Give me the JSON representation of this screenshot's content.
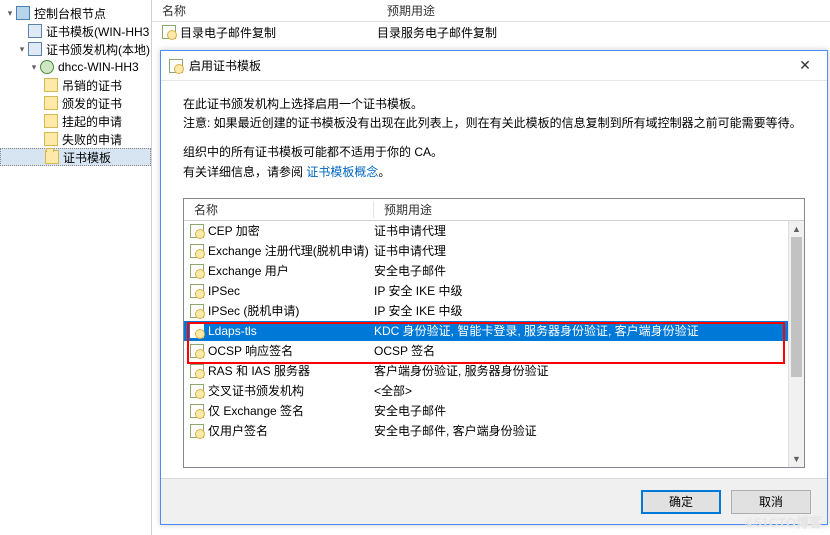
{
  "mmc": {
    "tree": {
      "root": "控制台根节点",
      "templates_node": "证书模板(WIN-HH3",
      "ca_node": "证书颁发机构(本地)",
      "ca_name": "dhcc-WIN-HH3",
      "revoked": "吊销的证书",
      "issued": "颁发的证书",
      "pending": "挂起的申请",
      "failed": "失败的申请",
      "cert_templates": "证书模板"
    },
    "columns": {
      "name": "名称",
      "purpose": "预期用途"
    },
    "rows": [
      {
        "name": "目录电子邮件复制",
        "purpose": "目录服务电子邮件复制"
      }
    ]
  },
  "dialog": {
    "title": "启用证书模板",
    "close_glyph": "✕",
    "instruction1": "在此证书颁发机构上选择启用一个证书模板。",
    "instruction2": "注意: 如果最近创建的证书模板没有出现在此列表上，则在有关此模板的信息复制到所有域控制器之前可能需要等待。",
    "instruction3_a": "组织中的所有证书模板可能都不适用于你的 CA。",
    "instruction3_b_prefix": "有关详细信息，请参阅 ",
    "instruction3_b_link": "证书模板概念",
    "instruction3_b_suffix": "。",
    "columns": {
      "name": "名称",
      "purpose": "预期用途"
    },
    "rows": [
      {
        "name": "CEP 加密",
        "purpose": "证书申请代理",
        "selected": false
      },
      {
        "name": "Exchange 注册代理(脱机申请)",
        "purpose": "证书申请代理",
        "selected": false
      },
      {
        "name": "Exchange 用户",
        "purpose": "安全电子邮件",
        "selected": false
      },
      {
        "name": "IPSec",
        "purpose": "IP 安全 IKE 中级",
        "selected": false
      },
      {
        "name": "IPSec (脱机申请)",
        "purpose": "IP 安全 IKE 中级",
        "selected": false
      },
      {
        "name": "Ldaps-tls",
        "purpose": "KDC 身份验证, 智能卡登录, 服务器身份验证, 客户端身份验证",
        "selected": true
      },
      {
        "name": "OCSP 响应签名",
        "purpose": "OCSP 签名",
        "selected": false
      },
      {
        "name": "RAS 和 IAS 服务器",
        "purpose": "客户端身份验证, 服务器身份验证",
        "selected": false
      },
      {
        "name": "交叉证书颁发机构",
        "purpose": "<全部>",
        "selected": false
      },
      {
        "name": "仅 Exchange 签名",
        "purpose": "安全电子邮件",
        "selected": false
      },
      {
        "name": "仅用户签名",
        "purpose": "安全电子邮件, 客户端身份验证",
        "selected": false
      }
    ],
    "buttons": {
      "ok": "确定",
      "cancel": "取消"
    }
  },
  "watermark": "©51CTO博客"
}
